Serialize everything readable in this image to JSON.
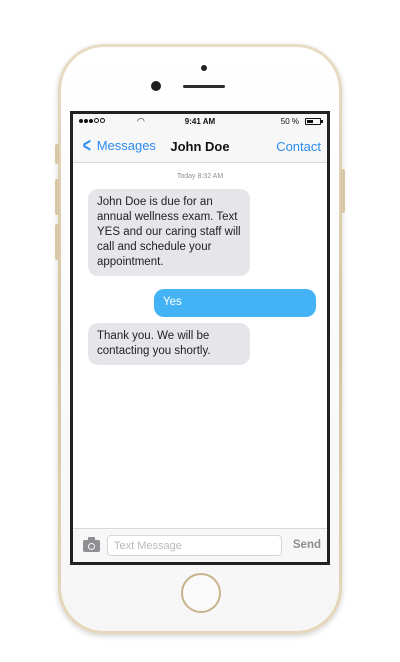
{
  "status_bar": {
    "time": "9:41 AM",
    "battery_percent": "50 %",
    "battery_level": 0.5,
    "wifi_icon": "wifi-icon"
  },
  "nav": {
    "back_label": "Messages",
    "title": "John Doe",
    "right_label": "Contact"
  },
  "thread": {
    "timestamp": "Today 8:32 AM",
    "messages": [
      {
        "direction": "incoming",
        "text": "John Doe is due for an annual wellness exam. Text YES and our caring staff will call and schedule your appointment."
      },
      {
        "direction": "outgoing",
        "text": "Yes"
      },
      {
        "direction": "incoming",
        "text": "Thank you. We will be contacting you shortly."
      }
    ]
  },
  "input_bar": {
    "placeholder": "Text Message",
    "value": "",
    "send_label": "Send"
  },
  "colors": {
    "accent": "#2a8cf0",
    "outgoing_bubble": "#44b3f5",
    "incoming_bubble": "#e5e5ea"
  }
}
